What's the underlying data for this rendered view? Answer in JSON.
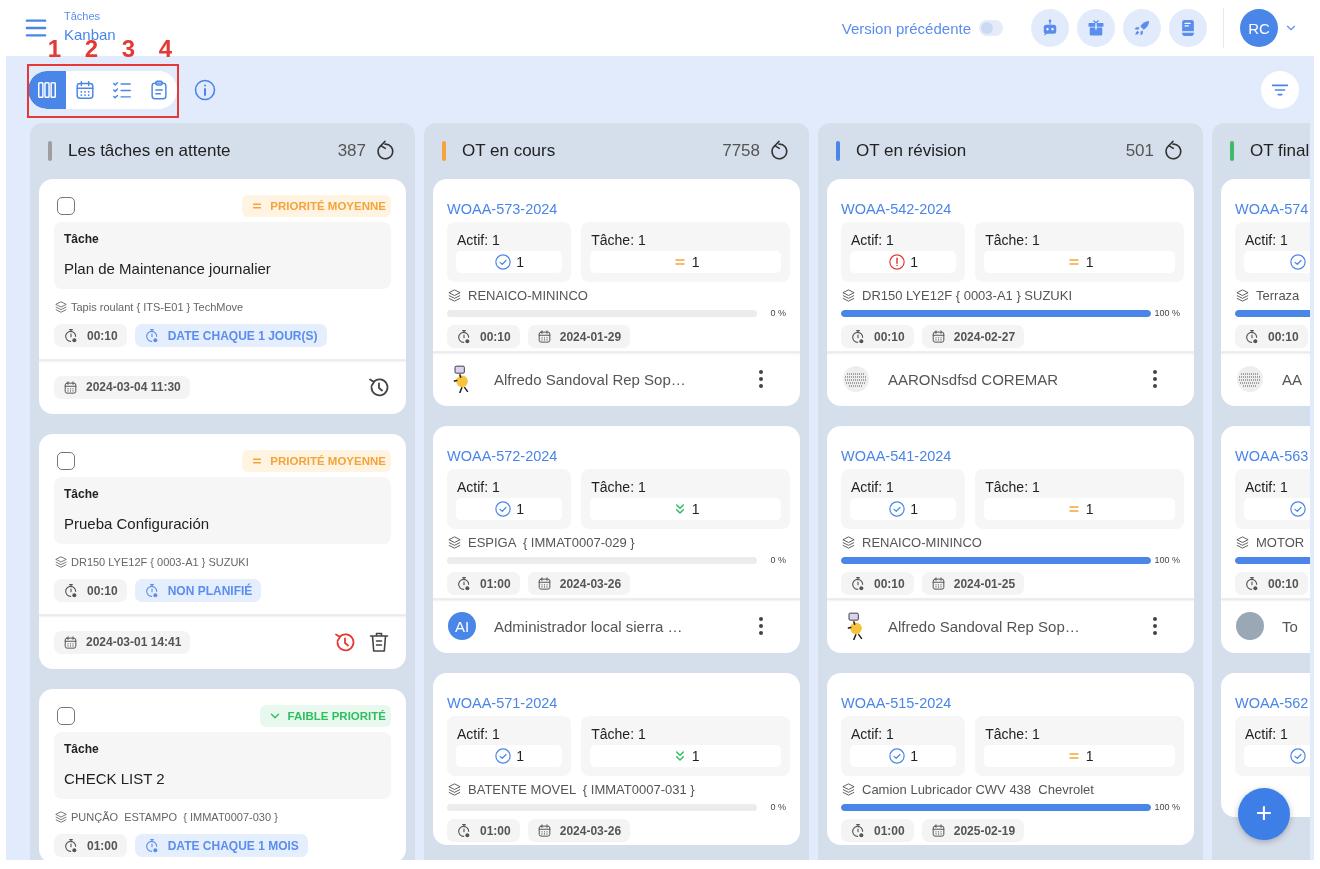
{
  "header": {
    "breadcrumb": "Tâches",
    "title": "Kanban",
    "legacy_toggle": {
      "label": "Version précédente",
      "on": false
    },
    "quick_actions": [
      {
        "kind": "robot"
      },
      {
        "kind": "gift"
      },
      {
        "kind": "rocket"
      },
      {
        "kind": "book"
      }
    ],
    "user": {
      "initials": "RC"
    }
  },
  "toolbar": {
    "views": [
      {
        "kind": "kanban",
        "selected": true
      },
      {
        "kind": "calendar",
        "selected": false
      },
      {
        "kind": "checklist",
        "selected": false
      },
      {
        "kind": "clipboard",
        "selected": false
      }
    ],
    "annotation_numbers": [
      "1",
      "2",
      "3",
      "4"
    ]
  },
  "columns": [
    {
      "title": "Les tâches en attente",
      "count": "387",
      "color": "#9e9e9e",
      "cards": [
        {
          "kind": "task",
          "checked": false,
          "priority": {
            "kind": "medium",
            "label": "PRIORITÉ MOYENNE"
          },
          "field_label": "Tâche",
          "title": "Plan de Maintenance journalier",
          "asset": "Tapis roulant { ITS-E01 } TechMove",
          "duration": "00:10",
          "schedule": "DATE CHAQUE 1 JOUR(S)",
          "date": "2024-03-04 11:30",
          "actions": [
            {
              "kind": "restore",
              "alert": false
            }
          ]
        },
        {
          "kind": "task",
          "checked": false,
          "priority": {
            "kind": "medium",
            "label": "PRIORITÉ MOYENNE"
          },
          "field_label": "Tâche",
          "title": "Prueba Configuración",
          "asset": "DR150 LYE12F { 0003-A1 } SUZUKI",
          "duration": "00:10",
          "schedule": "NON PLANIFIÉ",
          "date": "2024-03-01 14:41",
          "actions": [
            {
              "kind": "restore",
              "alert": true
            },
            {
              "kind": "delete",
              "alert": false
            }
          ]
        },
        {
          "kind": "task",
          "checked": false,
          "priority": {
            "kind": "low",
            "label": "FAIBLE PRIORITÉ"
          },
          "field_label": "Tâche",
          "title": "CHECK LIST 2",
          "asset": "PUNÇÃO  ESTAMPO  { IMMAT0007-030 }",
          "duration": "01:00",
          "schedule": "DATE CHAQUE 1 MOIS"
        }
      ]
    },
    {
      "title": "OT en cours",
      "count": "7758",
      "color": "#f5a33a",
      "cards": [
        {
          "kind": "work_order",
          "code": "WOAA-573-2024",
          "asset_summary": {
            "label": "Actif: 1",
            "alert": false,
            "count": "1"
          },
          "task_summary": {
            "label": "Tâche: 1",
            "kind": "medium",
            "count": "1"
          },
          "asset": "RENAICO-MININCO",
          "level": 0,
          "percent": "0 %",
          "duration": "00:10",
          "date": "2024-01-29",
          "assignee": {
            "kind": "illustration",
            "name": "Alfredo Sandoval Rep Sop…"
          }
        },
        {
          "kind": "work_order",
          "code": "WOAA-572-2024",
          "asset_summary": {
            "label": "Actif: 1",
            "alert": false,
            "count": "1"
          },
          "task_summary": {
            "label": "Tâche: 1",
            "kind": "low",
            "count": "1"
          },
          "asset": "ESPIGA  { IMMAT0007-029 }",
          "level": 0,
          "percent": "0 %",
          "duration": "01:00",
          "date": "2024-03-26",
          "assignee": {
            "kind": "initials",
            "initials": "AI",
            "name": "Administrador local sierra …"
          }
        },
        {
          "kind": "work_order",
          "code": "WOAA-571-2024",
          "asset_summary": {
            "label": "Actif: 1",
            "alert": false,
            "count": "1"
          },
          "task_summary": {
            "label": "Tâche: 1",
            "kind": "low",
            "count": "1"
          },
          "asset": "BATENTE MOVEL  { IMMAT0007-031 }",
          "level": 0,
          "percent": "0 %",
          "duration": "01:00",
          "date": "2024-03-26"
        }
      ]
    },
    {
      "title": "OT en révision",
      "count": "501",
      "color": "#4a86e8",
      "cards": [
        {
          "kind": "work_order",
          "code": "WOAA-542-2024",
          "asset_summary": {
            "label": "Actif: 1",
            "alert": true,
            "count": "1"
          },
          "task_summary": {
            "label": "Tâche: 1",
            "kind": "medium",
            "count": "1"
          },
          "asset": "DR150 LYE12F { 0003-A1 } SUZUKI",
          "level": 1,
          "percent": "100 %",
          "duration": "00:10",
          "date": "2024-02-27",
          "assignee": {
            "kind": "pattern",
            "name": "AARONsdfsd COREMAR"
          }
        },
        {
          "kind": "work_order",
          "code": "WOAA-541-2024",
          "asset_summary": {
            "label": "Actif: 1",
            "alert": false,
            "count": "1"
          },
          "task_summary": {
            "label": "Tâche: 1",
            "kind": "medium",
            "count": "1"
          },
          "asset": "RENAICO-MININCO",
          "level": 1,
          "percent": "100 %",
          "duration": "00:10",
          "date": "2024-01-25",
          "assignee": {
            "kind": "illustration",
            "name": "Alfredo Sandoval Rep Sop…"
          }
        },
        {
          "kind": "work_order",
          "code": "WOAA-515-2024",
          "asset_summary": {
            "label": "Actif: 1",
            "alert": false,
            "count": "1"
          },
          "task_summary": {
            "label": "Tâche: 1",
            "kind": "medium",
            "count": "1"
          },
          "asset": "Camion Lubricador CWV 438  Chevrolet",
          "level": 1,
          "percent": "100 %",
          "duration": "01:00",
          "date": "2025-02-19"
        }
      ]
    },
    {
      "title": "OT final",
      "color": "#3dbb6a",
      "cards": [
        {
          "kind": "work_order",
          "code": "WOAA-574",
          "asset_summary": {
            "label": "Actif: 1",
            "alert": false
          },
          "asset": "Terraza",
          "level": 1,
          "duration": "00:10",
          "assignee": {
            "kind": "pattern",
            "name": "AA"
          }
        },
        {
          "kind": "work_order",
          "code": "WOAA-563",
          "asset_summary": {
            "label": "Actif: 1",
            "alert": false
          },
          "asset": "MOTOR",
          "level": 1,
          "duration": "00:10",
          "assignee": {
            "kind": "photo",
            "name": "To"
          }
        },
        {
          "kind": "work_order",
          "code": "WOAA-562",
          "asset_summary": {
            "label": "Actif: 1",
            "alert": false
          }
        }
      ]
    }
  ],
  "fab": {
    "label": "+"
  }
}
